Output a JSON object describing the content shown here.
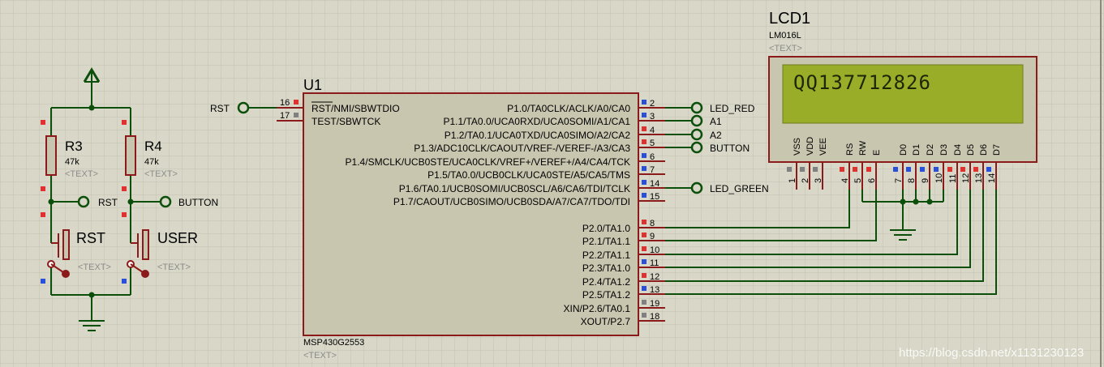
{
  "colors": {
    "background": "#d8d7c8",
    "grid": "#c4c3b2",
    "wire": "#0b4f0b",
    "body_outline": "#8b1a1a",
    "body_fill": "#c9c6b0",
    "lcd_screen": "#9aad28",
    "pin_red": "#e03030",
    "pin_blue": "#2a4fd8",
    "pin_gray": "#808080",
    "placeholder": "#8c8c8c"
  },
  "u1": {
    "ref": "U1",
    "part": "MSP430G2553",
    "text": "<TEXT>",
    "left_pins": [
      {
        "num": "16",
        "label": "RST/NMI/SBWTDIO",
        "overline": "RST"
      },
      {
        "num": "17",
        "label": "TEST/SBWTCK"
      }
    ],
    "right_pins": [
      {
        "num": "2",
        "label": "P1.0/TA0CLK/ACLK/A0/CA0"
      },
      {
        "num": "3",
        "label": "P1.1/TA0.0/UCA0RXD/UCA0SOMI/A1/CA1"
      },
      {
        "num": "4",
        "label": "P1.2/TA0.1/UCA0TXD/UCA0SIMO/A2/CA2"
      },
      {
        "num": "5",
        "label": "P1.3/ADC10CLK/CAOUT/VREF-/VEREF-/A3/CA3"
      },
      {
        "num": "6",
        "label": "P1.4/SMCLK/UCB0STE/UCA0CLK/VREF+/VEREF+/A4/CA4/TCK"
      },
      {
        "num": "7",
        "label": "P1.5/TA0.0/UCB0CLK/UCA0STE/A5/CA5/TMS"
      },
      {
        "num": "14",
        "label": "P1.6/TA0.1/UCB0SOMI/UCB0SCL/A6/CA6/TDI/TCLK"
      },
      {
        "num": "15",
        "label": "P1.7/CAOUT/UCB0SIMO/UCB0SDA/A7/CA7/TDO/TDI"
      },
      {
        "num": "8",
        "label": "P2.0/TA1.0"
      },
      {
        "num": "9",
        "label": "P2.1/TA1.1"
      },
      {
        "num": "10",
        "label": "P2.2/TA1.1"
      },
      {
        "num": "11",
        "label": "P2.3/TA1.0"
      },
      {
        "num": "12",
        "label": "P2.4/TA1.2"
      },
      {
        "num": "13",
        "label": "P2.5/TA1.2"
      },
      {
        "num": "19",
        "label": "XIN/P2.6/TA0.1"
      },
      {
        "num": "18",
        "label": "XOUT/P2.7"
      }
    ]
  },
  "lcd": {
    "ref": "LCD1",
    "part": "LM016L",
    "text": "<TEXT>",
    "display": "QQ137712826",
    "pins": [
      {
        "num": "1",
        "label": "VSS"
      },
      {
        "num": "2",
        "label": "VDD"
      },
      {
        "num": "3",
        "label": "VEE"
      },
      {
        "num": "4",
        "label": "RS"
      },
      {
        "num": "5",
        "label": "RW"
      },
      {
        "num": "6",
        "label": "E"
      },
      {
        "num": "7",
        "label": "D0"
      },
      {
        "num": "8",
        "label": "D1"
      },
      {
        "num": "9",
        "label": "D2"
      },
      {
        "num": "10",
        "label": "D3"
      },
      {
        "num": "11",
        "label": "D4"
      },
      {
        "num": "12",
        "label": "D5"
      },
      {
        "num": "13",
        "label": "D6"
      },
      {
        "num": "14",
        "label": "D7"
      }
    ]
  },
  "r3": {
    "ref": "R3",
    "value": "47k",
    "text": "<TEXT>"
  },
  "r4": {
    "ref": "R4",
    "value": "47k",
    "text": "<TEXT>"
  },
  "sw_rst": {
    "ref": "RST",
    "text": "<TEXT>"
  },
  "sw_user": {
    "ref": "USER",
    "text": "<TEXT>"
  },
  "terminals": {
    "rst_left": "RST",
    "rst_mid": "RST",
    "button_mid": "BUTTON",
    "led_red": "LED_RED",
    "a1": "A1",
    "a2": "A2",
    "button_right": "BUTTON",
    "led_green": "LED_GREEN"
  },
  "watermark": "https://blog.csdn.net/x1131230123"
}
